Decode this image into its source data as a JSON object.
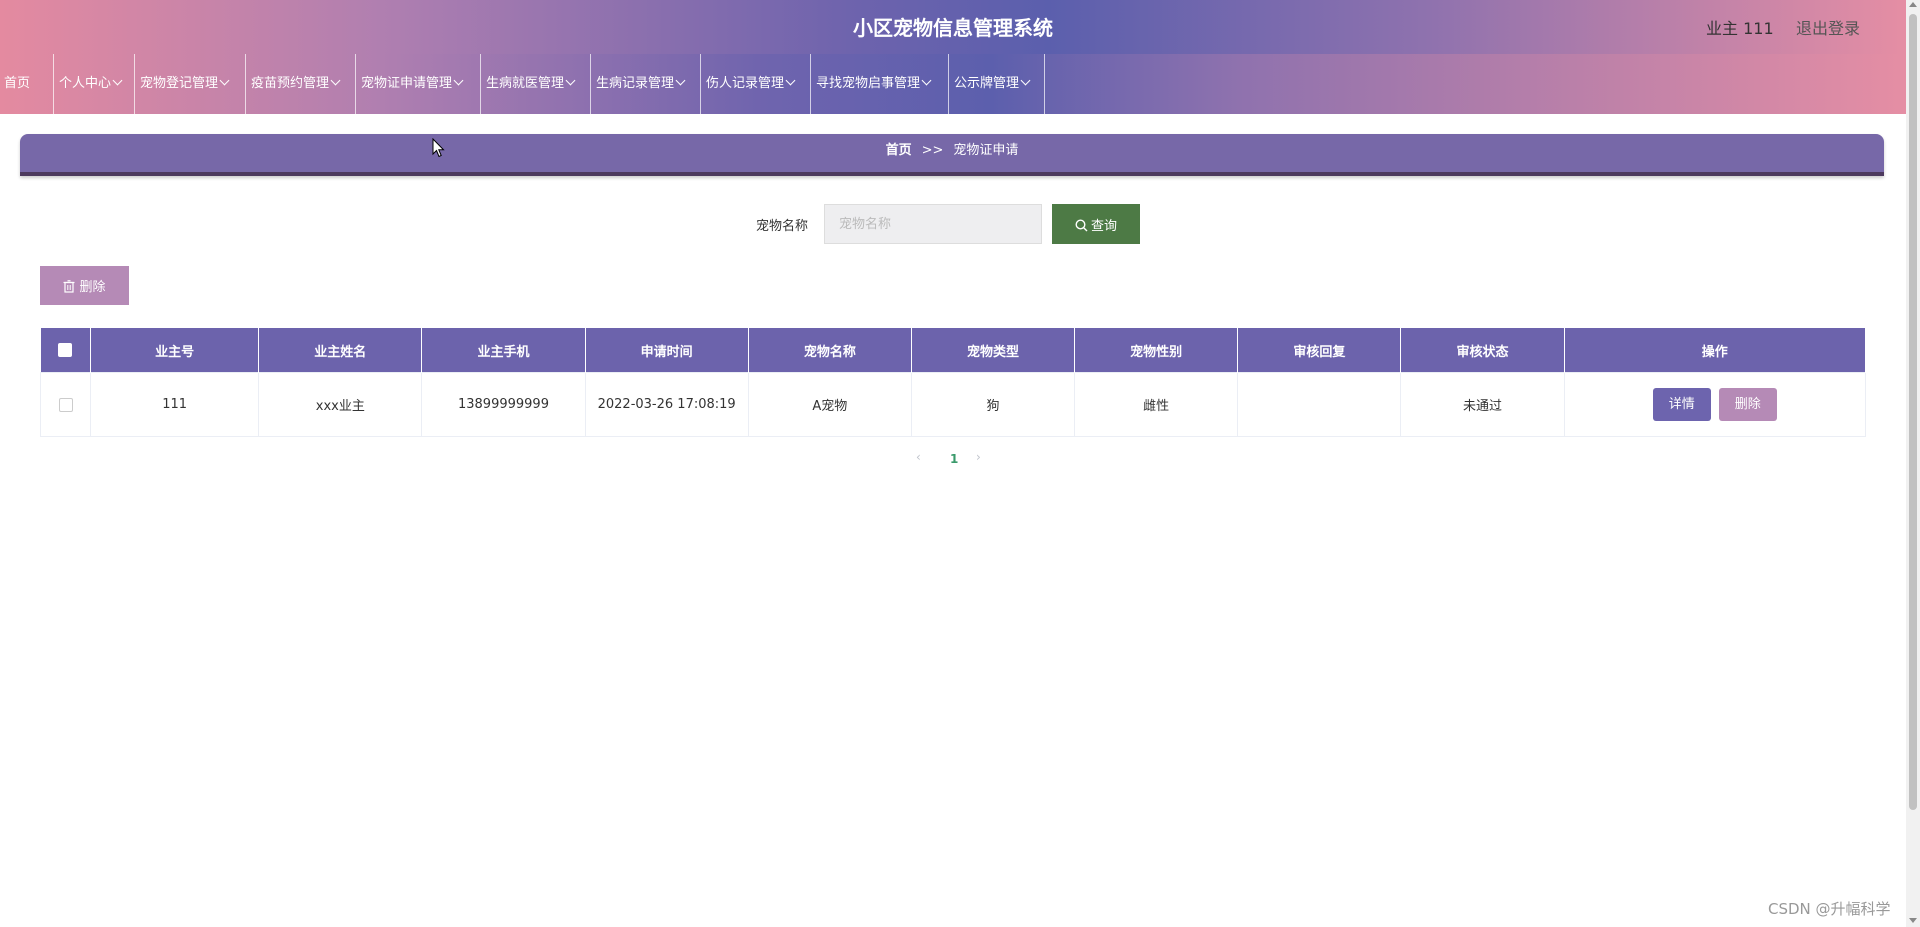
{
  "header": {
    "title": "小区宠物信息管理系统",
    "user": "业主 111",
    "logout": "退出登录"
  },
  "nav": {
    "items": [
      {
        "label": "首页",
        "dropdown": false
      },
      {
        "label": "个人中心",
        "dropdown": true
      },
      {
        "label": "宠物登记管理",
        "dropdown": true
      },
      {
        "label": "疫苗预约管理",
        "dropdown": true
      },
      {
        "label": "宠物证申请管理",
        "dropdown": true
      },
      {
        "label": "生病就医管理",
        "dropdown": true
      },
      {
        "label": "生病记录管理",
        "dropdown": true
      },
      {
        "label": "伤人记录管理",
        "dropdown": true
      },
      {
        "label": "寻找宠物启事管理",
        "dropdown": true
      },
      {
        "label": "公示牌管理",
        "dropdown": true
      }
    ]
  },
  "breadcrumb": {
    "home": "首页",
    "separator": ">>",
    "current": "宠物证申请"
  },
  "search": {
    "label": "宠物名称",
    "placeholder": "宠物名称",
    "button": "查询"
  },
  "toolbar": {
    "delete_label": "删除"
  },
  "table": {
    "columns": [
      "业主号",
      "业主姓名",
      "业主手机",
      "申请时间",
      "宠物名称",
      "宠物类型",
      "宠物性别",
      "审核回复",
      "审核状态",
      "操作"
    ],
    "rows": [
      {
        "owner_id": "111",
        "owner_name": "xxx业主",
        "owner_phone": "13899999999",
        "apply_time": "2022-03-26 17:08:19",
        "pet_name": "A宠物",
        "pet_type": "狗",
        "pet_gender": "雌性",
        "review_reply": "",
        "review_status": "未通过",
        "detail_label": "详情",
        "delete_label": "删除"
      }
    ]
  },
  "pagination": {
    "current_page": "1"
  },
  "watermark": "CSDN @升幅科学",
  "colors": {
    "nav_accent": "#6c63ac",
    "search_button": "#4d7a45",
    "delete_button": "#b58ab6",
    "pagination_active": "#3a9a6b"
  }
}
